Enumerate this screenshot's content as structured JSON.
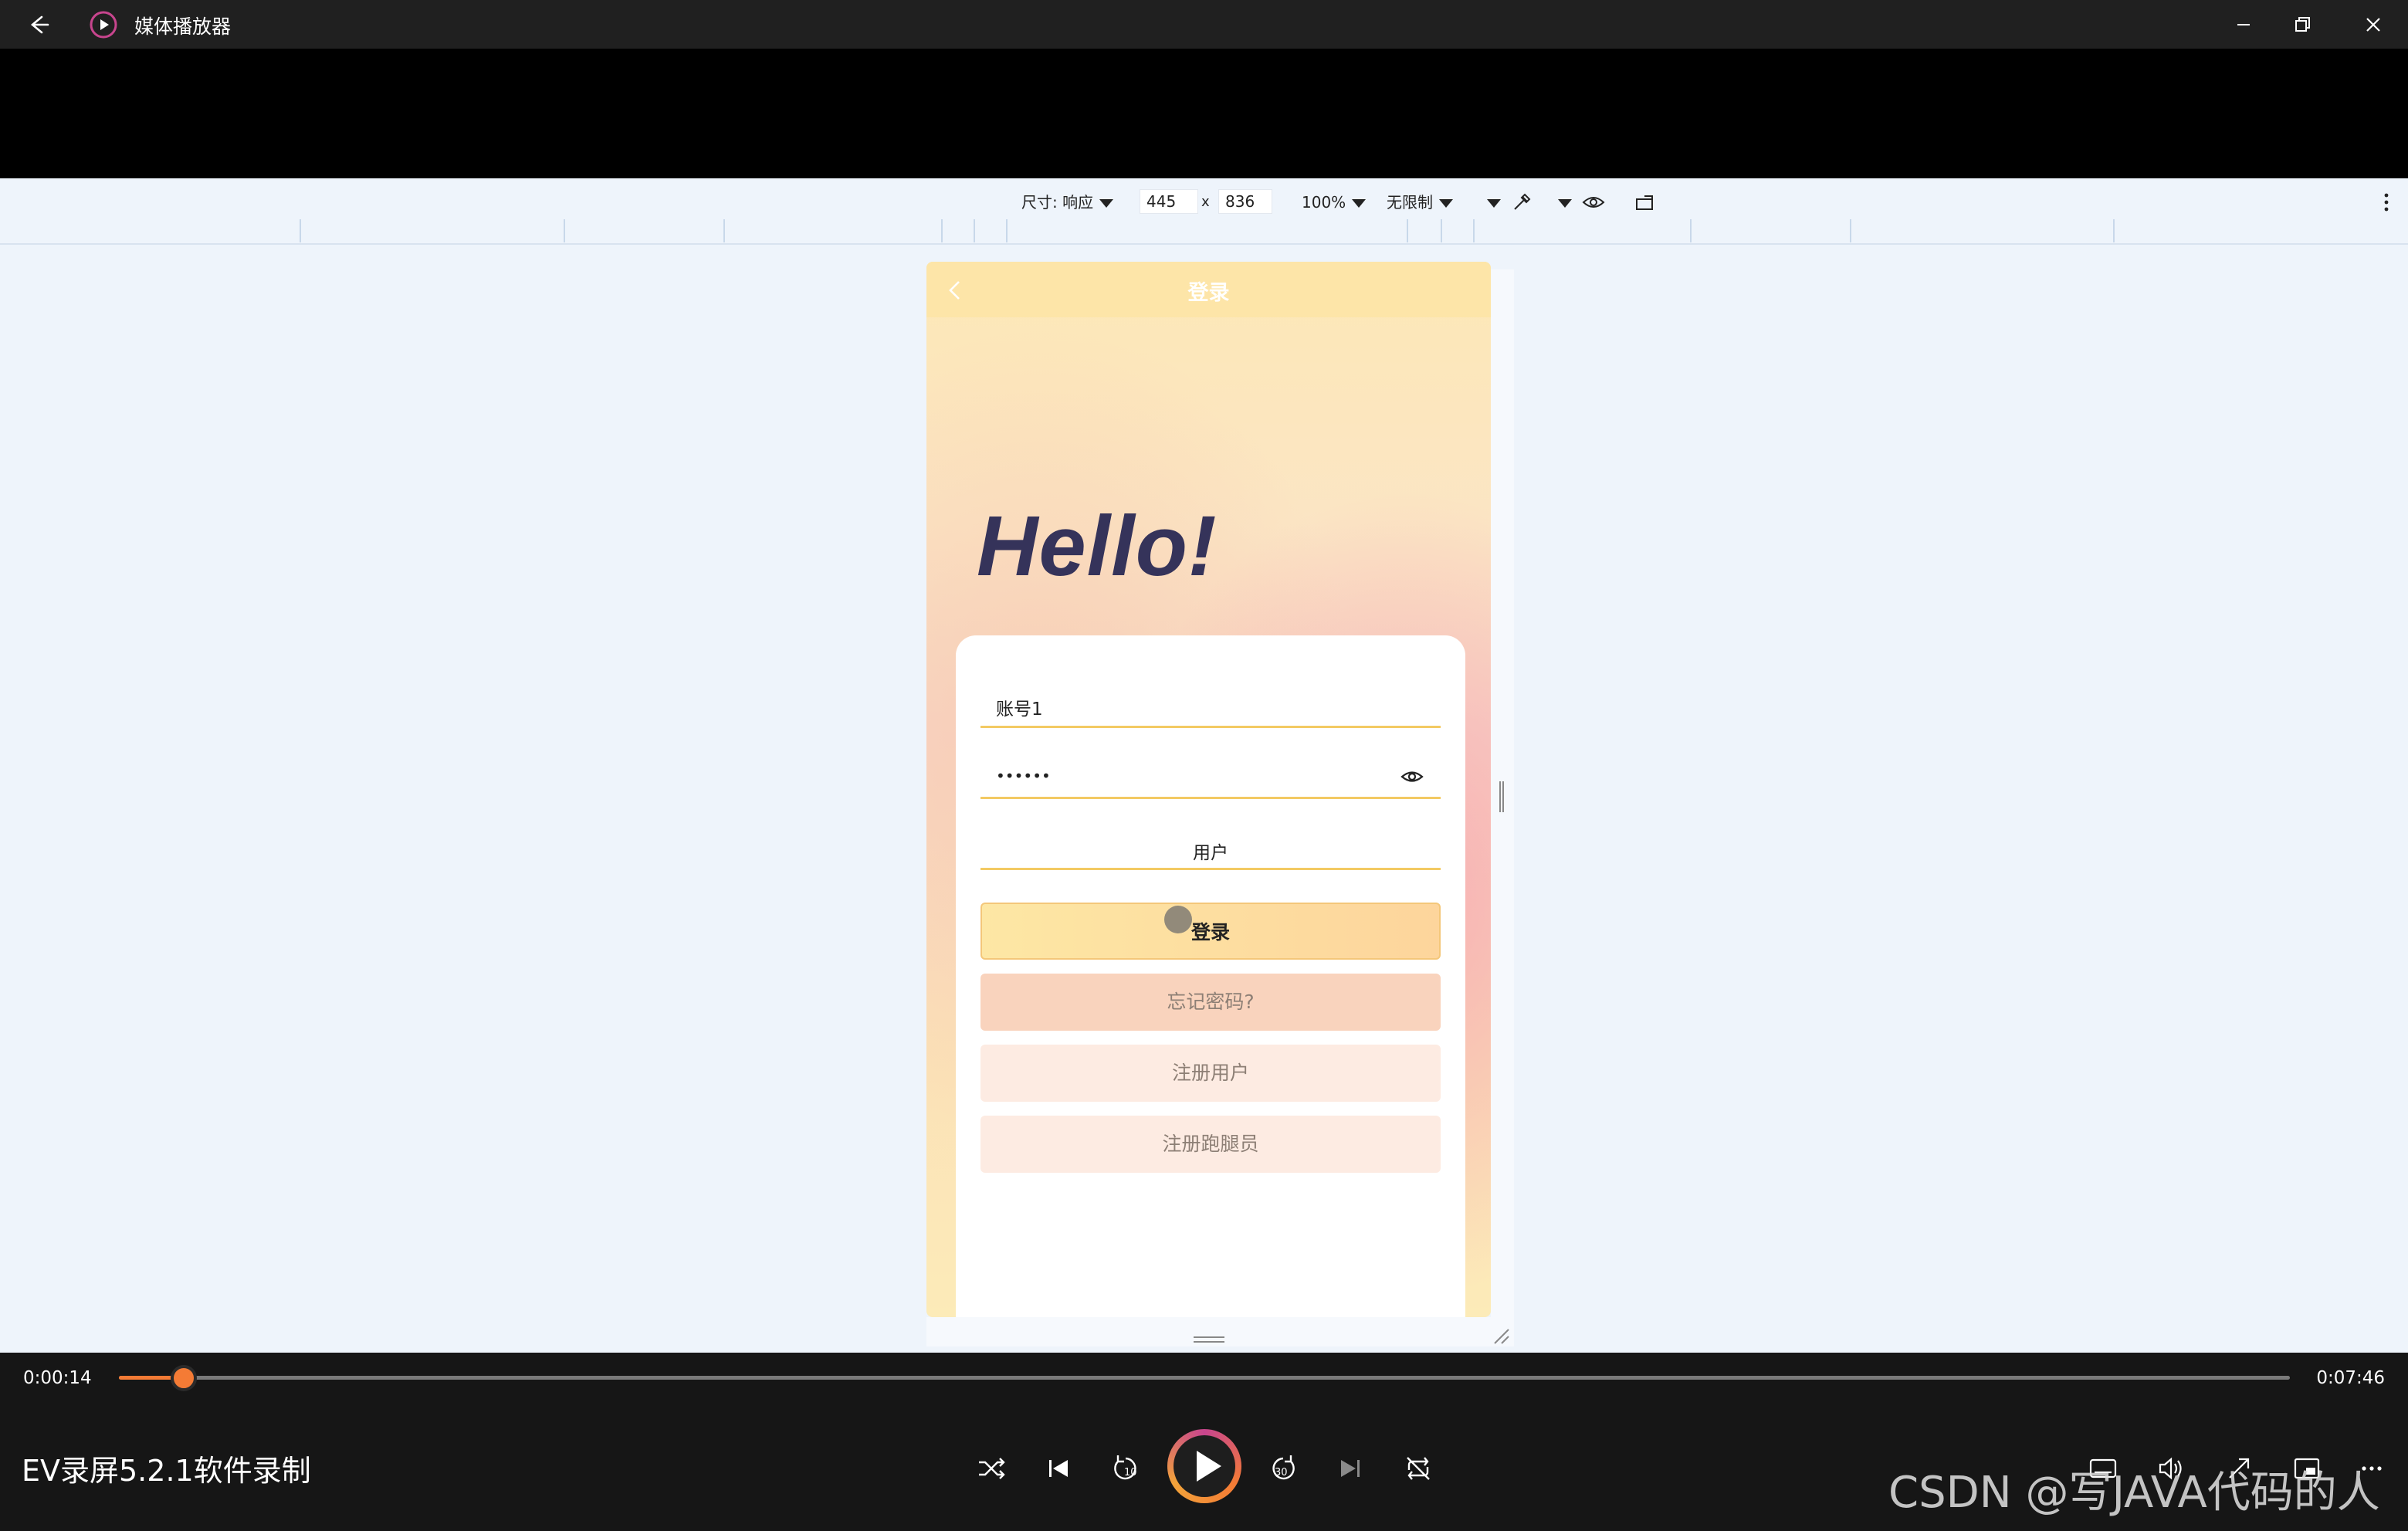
{
  "app": {
    "title": "媒体播放器",
    "window_controls": [
      "minimize-icon",
      "restore-icon",
      "close-icon"
    ]
  },
  "devtools": {
    "size_label": "尺寸: 响应",
    "width": "445",
    "times": "x",
    "height": "836",
    "zoom": "100%",
    "throttle": "无限制"
  },
  "phone": {
    "nav_title": "登录",
    "hello": "Hello!",
    "account_value": "账号1",
    "password_value": "••••••",
    "role_value": "用户",
    "login_button": "登录",
    "forgot_button": "忘记密码?",
    "register_user_button": "注册用户",
    "register_runner_button": "注册跑腿员"
  },
  "player": {
    "current_time": "0:00:14",
    "total_time": "0:07:46",
    "progress_fraction": 0.03,
    "media_title": "EV录屏5.2.1软件录制",
    "skip_back_seconds": "10",
    "skip_forward_seconds": "30",
    "accent_color": "#f47b35"
  },
  "watermark": "CSDN @写JAVA代码的人"
}
